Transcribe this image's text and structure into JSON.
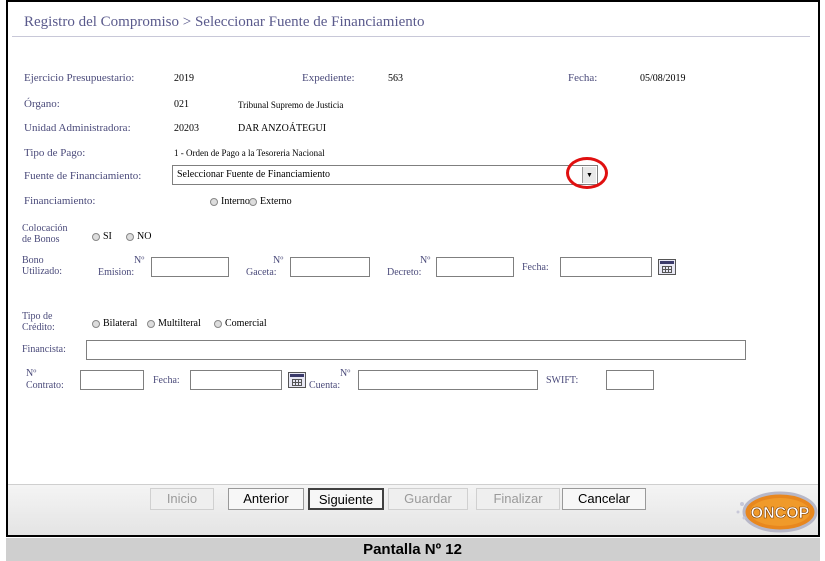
{
  "title": "Registro del Compromiso > Seleccionar Fuente de Financiamiento",
  "fields": {
    "ejercicio_label": "Ejercicio Presupuestario:",
    "ejercicio_value": "2019",
    "expediente_label": "Expediente:",
    "expediente_value": "563",
    "fecha_label": "Fecha:",
    "fecha_value": "05/08/2019",
    "organo_label": "Órgano:",
    "organo_code": "021",
    "organo_name": "Tribunal Supremo de Justicia",
    "unidad_label": "Unidad Administradora:",
    "unidad_code": "20203",
    "unidad_name": "DAR ANZOÁTEGUI",
    "tipo_pago_label": "Tipo de Pago:",
    "tipo_pago_value": "1 - Orden de Pago a la Tesoreria Nacional",
    "fuente_label": "Fuente de Financiamiento:",
    "fuente_selected": "Seleccionar Fuente de Financiamiento",
    "financiamiento_label": "Financiamiento:",
    "financiamiento_opt1": "Interno",
    "financiamiento_opt2": "Externo"
  },
  "bonos": {
    "colocacion_label_1": "Colocación",
    "colocacion_label_2": "de Bonos",
    "si": "SI",
    "no": "NO",
    "bono_label_1": "Bono",
    "bono_label_2": "Utilizado:",
    "n1": "Nº",
    "emision": "Emision:",
    "n2": "Nº",
    "gaceta": "Gaceta:",
    "n3": "Nº",
    "decreto": "Decreto:",
    "fecha": "Fecha:"
  },
  "credito": {
    "tipo_label_1": "Tipo de",
    "tipo_label_2": "Crédito:",
    "opt1": "Bilateral",
    "opt2": "Multilteral",
    "opt3": "Comercial",
    "financista_label": "Financista:",
    "n_contrato": "Nº",
    "contrato": "Contrato:",
    "fecha": "Fecha:",
    "n_cuenta": "Nº",
    "cuenta": "Cuenta:",
    "swift": "SWIFT:"
  },
  "toolbar": {
    "inicio": "Inicio",
    "anterior": "Anterior",
    "siguiente": "Siguiente",
    "guardar": "Guardar",
    "finalizar": "Finalizar",
    "cancelar": "Cancelar"
  },
  "logo": {
    "text": "ONCOP"
  },
  "caption": "Pantalla Nº 12",
  "colors": {
    "label": "#4a4a7a",
    "highlight": "#e01010",
    "logo_orange": "#e8871e"
  }
}
